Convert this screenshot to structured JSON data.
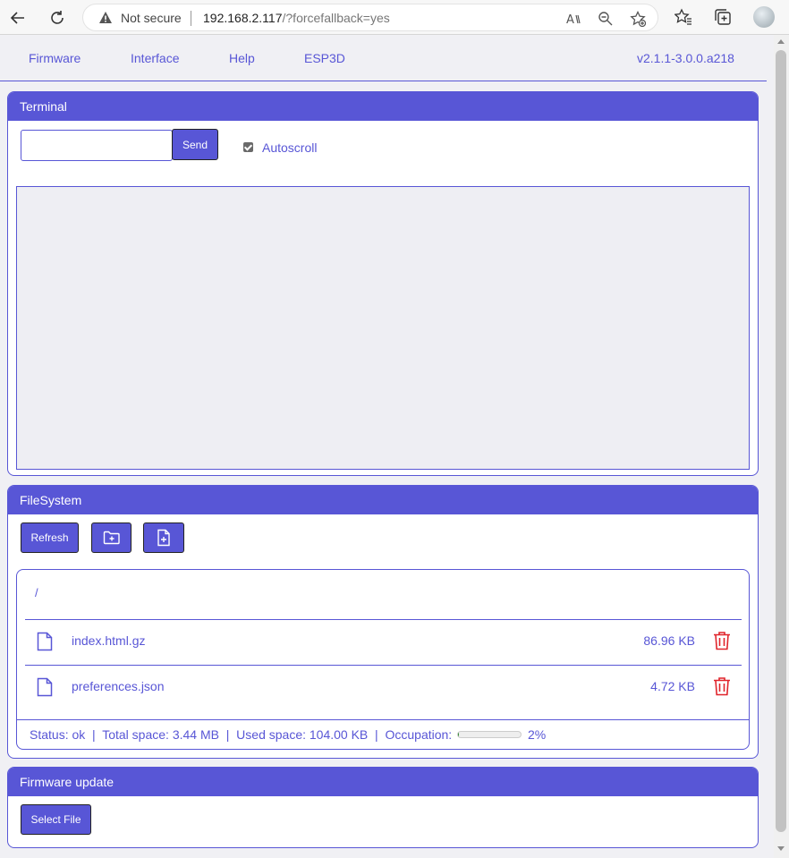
{
  "browser": {
    "security_label": "Not secure",
    "url_host": "192.168.2.117",
    "url_path": "/?forcefallback=yes"
  },
  "nav": {
    "items": [
      "Firmware",
      "Interface",
      "Help",
      "ESP3D"
    ],
    "version": "v2.1.1-3.0.0.a218"
  },
  "terminal": {
    "title": "Terminal",
    "input_value": "",
    "send_label": "Send",
    "autoscroll_label": "Autoscroll",
    "autoscroll_checked": true
  },
  "filesystem": {
    "title": "FileSystem",
    "refresh_label": "Refresh",
    "path": "/",
    "files": [
      {
        "name": "index.html.gz",
        "size": "86.96 KB"
      },
      {
        "name": "preferences.json",
        "size": "4.72 KB"
      }
    ],
    "status": {
      "status_text": "Status: ok",
      "total_text": "Total space: 3.44 MB",
      "used_text": "Used space: 104.00 KB",
      "occupation_label": "Occupation:",
      "occupation_percent": 2,
      "occupation_text": "2%"
    }
  },
  "firmware_update": {
    "title": "Firmware update",
    "select_label": "Select File"
  },
  "colors": {
    "accent": "#5856d6",
    "danger": "#e0242b",
    "progress": "#2d8a2d"
  }
}
